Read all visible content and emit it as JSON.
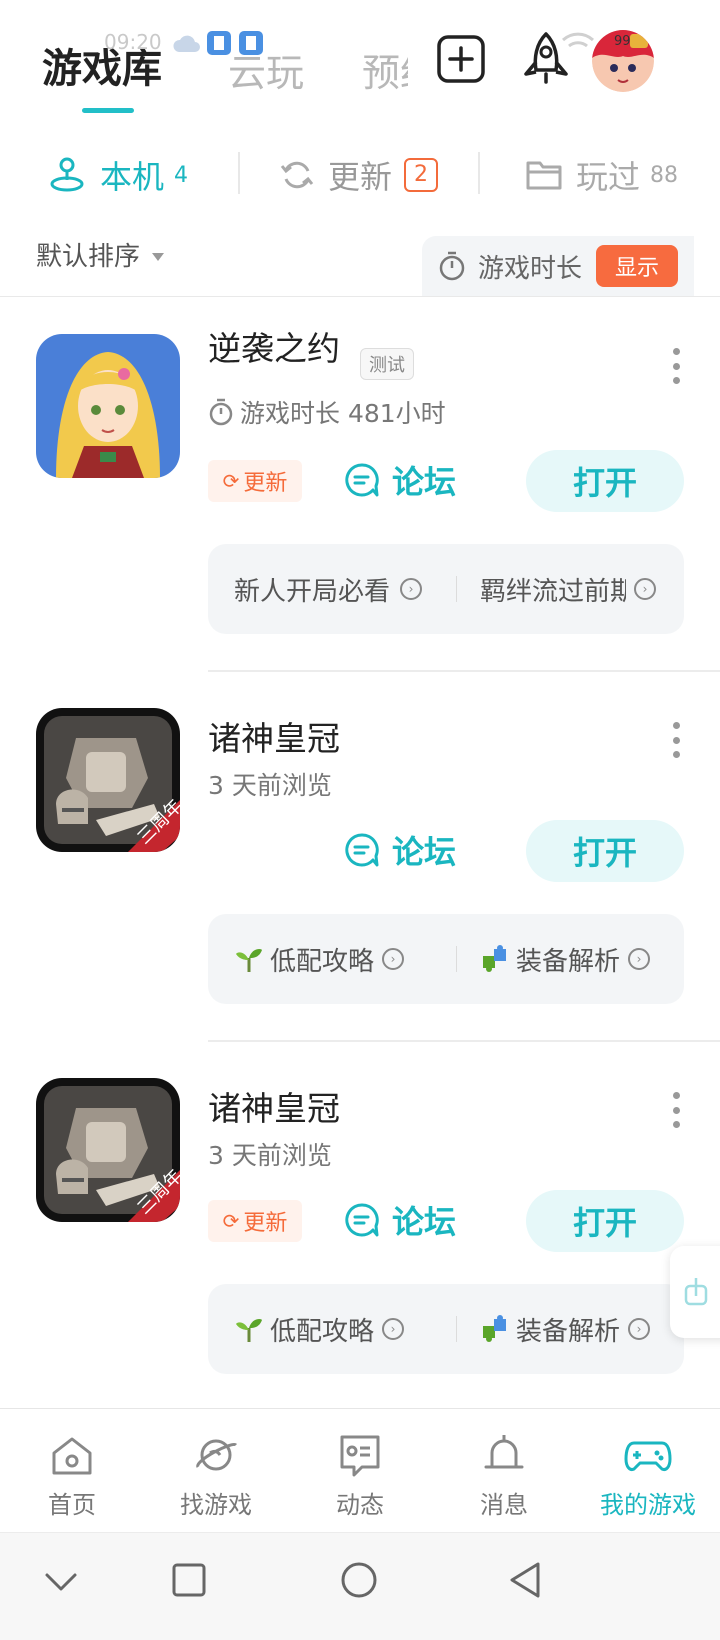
{
  "status_bar": {
    "time": "09:20"
  },
  "header": {
    "tabs": [
      {
        "label": "游戏库"
      },
      {
        "label": "云玩"
      },
      {
        "label": "预约"
      }
    ],
    "avatar_badge": "99"
  },
  "sub_tabs": [
    {
      "label": "本机",
      "count": "4"
    },
    {
      "label": "更新",
      "count": "2"
    },
    {
      "label": "玩过",
      "count": "88"
    }
  ],
  "sort": {
    "label": "默认排序"
  },
  "duration_toggle": {
    "label": "游戏时长",
    "button": "显示"
  },
  "games": [
    {
      "title": "逆袭之约",
      "tag": "测试",
      "meta": "游戏时长 481小时",
      "update_label": "更新",
      "forum_label": "论坛",
      "open_label": "打开",
      "guides": [
        "新人开局必看",
        "羁绊流过前期"
      ]
    },
    {
      "title": "诸神皇冠",
      "meta": "3 天前浏览",
      "forum_label": "论坛",
      "open_label": "打开",
      "guides": [
        "低配攻略",
        "装备解析"
      ],
      "icon_ribbon": "三周年"
    },
    {
      "title": "诸神皇冠",
      "meta": "3 天前浏览",
      "update_label": "更新",
      "forum_label": "论坛",
      "open_label": "打开",
      "guides": [
        "低配攻略",
        "装备解析"
      ],
      "icon_ribbon": "三周年"
    }
  ],
  "bottom_nav": [
    {
      "label": "首页",
      "icon": "home-icon"
    },
    {
      "label": "找游戏",
      "icon": "planet-icon"
    },
    {
      "label": "动态",
      "icon": "feed-icon"
    },
    {
      "label": "消息",
      "icon": "bell-icon"
    },
    {
      "label": "我的游戏",
      "icon": "gamepad-icon"
    }
  ],
  "colors": {
    "accent": "#1ab6c0",
    "orange": "#f56b3a"
  }
}
